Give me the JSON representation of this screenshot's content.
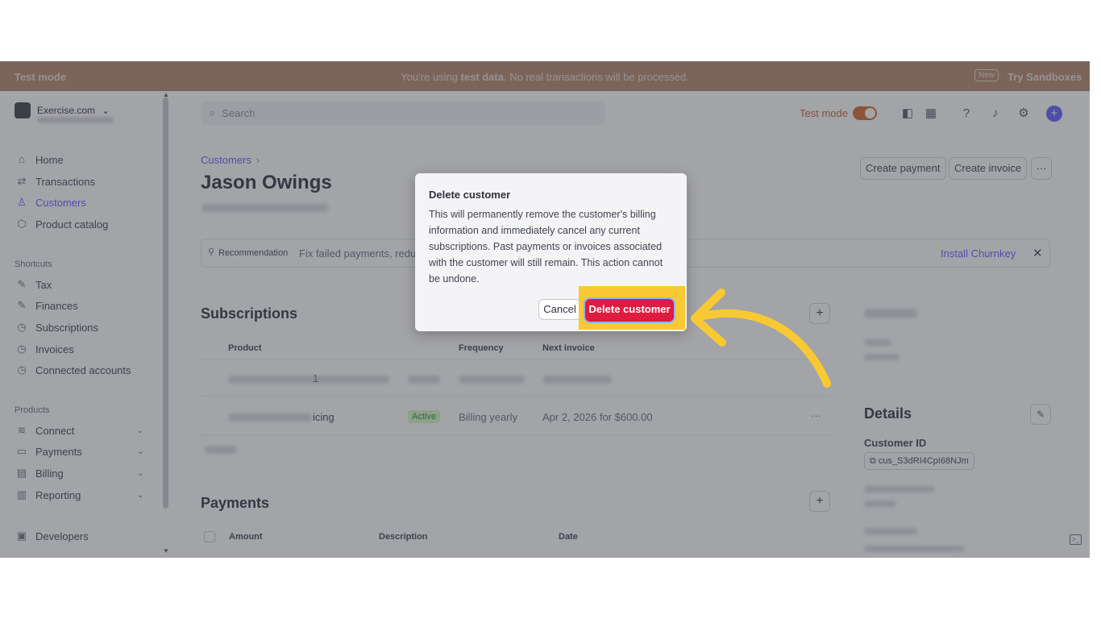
{
  "banner": {
    "left": "Test mode",
    "message_pre": "You're using ",
    "message_bold": "test data",
    "message_post": ". No real transactions will be processed.",
    "new_badge": "New",
    "sandbox": "Try Sandboxes"
  },
  "sidebar": {
    "account": "Exercise.com",
    "account_chevron": "⌄",
    "items": [
      {
        "label": "Home",
        "icon": "home-icon",
        "glyph": "⌂"
      },
      {
        "label": "Transactions",
        "icon": "transactions-icon",
        "glyph": "⇄"
      },
      {
        "label": "Customers",
        "icon": "user-icon",
        "glyph": "♙"
      },
      {
        "label": "Product catalog",
        "icon": "box-icon",
        "glyph": "⬡"
      }
    ],
    "shortcuts_title": "Shortcuts",
    "shortcuts": [
      {
        "label": "Tax",
        "icon": "pin-icon",
        "glyph": "✎"
      },
      {
        "label": "Finances",
        "icon": "pin-icon",
        "glyph": "✎"
      },
      {
        "label": "Subscriptions",
        "icon": "clock-icon",
        "glyph": "◷"
      },
      {
        "label": "Invoices",
        "icon": "clock-icon",
        "glyph": "◷"
      },
      {
        "label": "Connected accounts",
        "icon": "clock-icon",
        "glyph": "◷"
      }
    ],
    "products_title": "Products",
    "products": [
      {
        "label": "Connect",
        "icon": "layers-icon",
        "glyph": "≋"
      },
      {
        "label": "Payments",
        "icon": "wallet-icon",
        "glyph": "▭"
      },
      {
        "label": "Billing",
        "icon": "billing-icon",
        "glyph": "▤"
      },
      {
        "label": "Reporting",
        "icon": "chart-icon",
        "glyph": "▥"
      }
    ],
    "chevron": "⌄",
    "developers": "Developers",
    "developers_glyph": "▣"
  },
  "topbar": {
    "search_placeholder": "Search",
    "search_glyph": "⌕",
    "test_mode": "Test mode",
    "icons": {
      "apps": "▦",
      "help": "?",
      "bell": "♪",
      "gear": "⚙",
      "plus": "+",
      "app": "◧"
    }
  },
  "page": {
    "breadcrumb": "Customers",
    "breadcrumb_sep": "›",
    "title": "Jason Owings",
    "create_payment": "Create payment",
    "create_invoice": "Create invoice",
    "more": "···"
  },
  "recommendation": {
    "pin": "⚲",
    "label": "Recommendation",
    "text": "Fix failed payments, reduc",
    "install": "Install Churnkey",
    "close": "✕"
  },
  "subscriptions": {
    "title": "Subscriptions",
    "add": "+",
    "headers": {
      "product": "Product",
      "frequency": "Frequency",
      "next_invoice": "Next invoice"
    },
    "row1_fragment": "1",
    "row2": {
      "product_fragment": "icing",
      "status": "Active",
      "frequency": "Billing yearly",
      "next_invoice": "Apr 2, 2026 for $600.00"
    },
    "row_more": "···"
  },
  "payments": {
    "title": "Payments",
    "add": "+",
    "headers": {
      "amount": "Amount",
      "description": "Description",
      "date": "Date"
    }
  },
  "details": {
    "title": "Details",
    "edit_glyph": "✎",
    "customer_id_label": "Customer ID",
    "customer_id": "cus_S3dRI4CpI68NJm",
    "copy_glyph": "⧉"
  },
  "dialog": {
    "title": "Delete customer",
    "body": "This will permanently remove the customer's billing information and immediately cancel any current subscriptions. Past payments or invoices associated with the customer will still remain. This action cannot be undone.",
    "cancel": "Cancel",
    "confirm": "Delete customer"
  },
  "colors": {
    "accent": "#635bff",
    "danger": "#df1b41",
    "highlight": "#f9c933",
    "banner": "#b4886c"
  }
}
